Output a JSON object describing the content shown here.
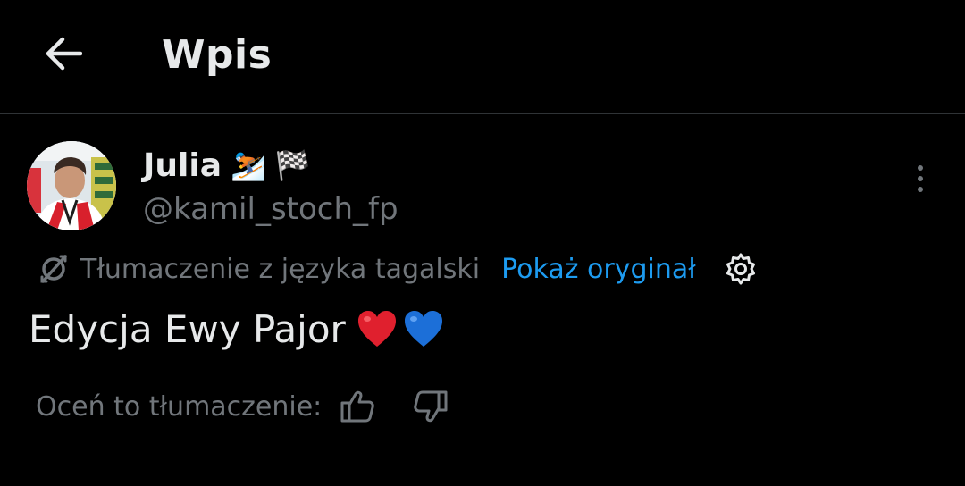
{
  "header": {
    "back_icon": "arrow-left-icon",
    "title": "Wpis"
  },
  "post": {
    "author": {
      "display_name": "Julia",
      "badges": [
        "⛷️",
        "🏁"
      ],
      "handle": "@kamil_stoch_fp",
      "avatar_icon": "avatar-image"
    },
    "more_icon": "more-vertical-icon",
    "translation": {
      "icon": "translate-icon",
      "label": "Tłumaczenie z języka tagalski",
      "show_original": "Pokaż oryginał",
      "settings_icon": "gear-icon"
    },
    "text": "Edycja Ewy Pajor",
    "emojis": [
      "red-heart",
      "blue-heart"
    ],
    "rating": {
      "label": "Oceń to tłumaczenie:",
      "thumb_up_icon": "thumb-up-icon",
      "thumb_down_icon": "thumb-down-icon"
    }
  },
  "colors": {
    "background": "#000000",
    "primary_text": "#e7e9ea",
    "secondary_text": "#71767b",
    "link": "#1d9bf0",
    "divider": "#2f3336",
    "heart_red": "#e0202e",
    "heart_blue": "#1c6fd8"
  }
}
